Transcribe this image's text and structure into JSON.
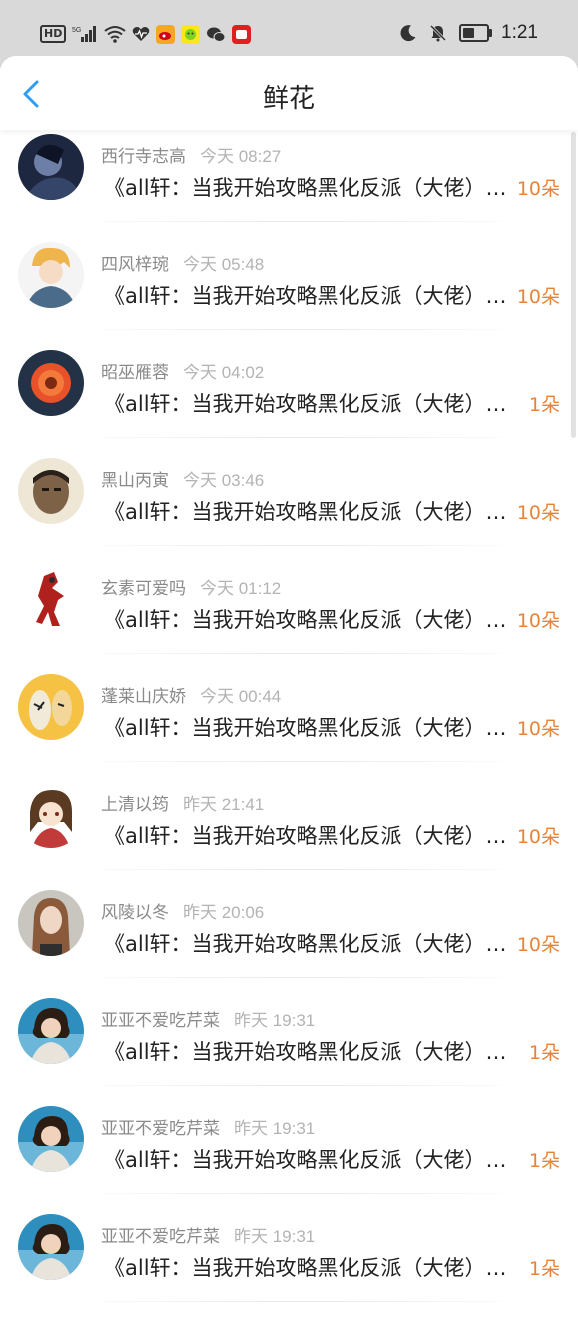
{
  "status_bar": {
    "hd": "HD",
    "network": "5G",
    "time": "1:21",
    "battery_level": 0.5
  },
  "header": {
    "title": "鲜花"
  },
  "records": [
    {
      "name": "西行寺志高",
      "time": "今天 08:27",
      "content": "《all轩：当我开始攻略黑化反派（大佬）…》",
      "amount": "10朵"
    },
    {
      "name": "四风梓琬",
      "time": "今天 05:48",
      "content": "《all轩：当我开始攻略黑化反派（大佬）…》",
      "amount": "10朵"
    },
    {
      "name": "昭巫雁蓉",
      "time": "今天 04:02",
      "content": "《all轩：当我开始攻略黑化反派（大佬）…》",
      "amount": "1朵"
    },
    {
      "name": "黑山丙寅",
      "time": "今天 03:46",
      "content": "《all轩：当我开始攻略黑化反派（大佬）…》",
      "amount": "10朵"
    },
    {
      "name": "玄素可爱吗",
      "time": "今天 01:12",
      "content": "《all轩：当我开始攻略黑化反派（大佬）…》",
      "amount": "10朵"
    },
    {
      "name": "蓬莱山庆娇",
      "time": "今天 00:44",
      "content": "《all轩：当我开始攻略黑化反派（大佬）…》",
      "amount": "10朵"
    },
    {
      "name": "上清以筠",
      "time": "昨天 21:41",
      "content": "《all轩：当我开始攻略黑化反派（大佬）…》",
      "amount": "10朵"
    },
    {
      "name": "风陵以冬",
      "time": "昨天 20:06",
      "content": "《all轩：当我开始攻略黑化反派（大佬）…》",
      "amount": "10朵"
    },
    {
      "name": "亚亚不爱吃芹菜",
      "time": "昨天 19:31",
      "content": "《all轩：当我开始攻略黑化反派（大佬）…》",
      "amount": "1朵"
    },
    {
      "name": "亚亚不爱吃芹菜",
      "time": "昨天 19:31",
      "content": "《all轩：当我开始攻略黑化反派（大佬）…》",
      "amount": "1朵"
    },
    {
      "name": "亚亚不爱吃芹菜",
      "time": "昨天 19:31",
      "content": "《all轩：当我开始攻略黑化反派（大佬）…》",
      "amount": "1朵"
    }
  ],
  "colors": {
    "accent_back": "#2f9df4",
    "amount": "#e8833a",
    "name": "#8a8a8a",
    "timestamp": "#b3b3b3"
  }
}
